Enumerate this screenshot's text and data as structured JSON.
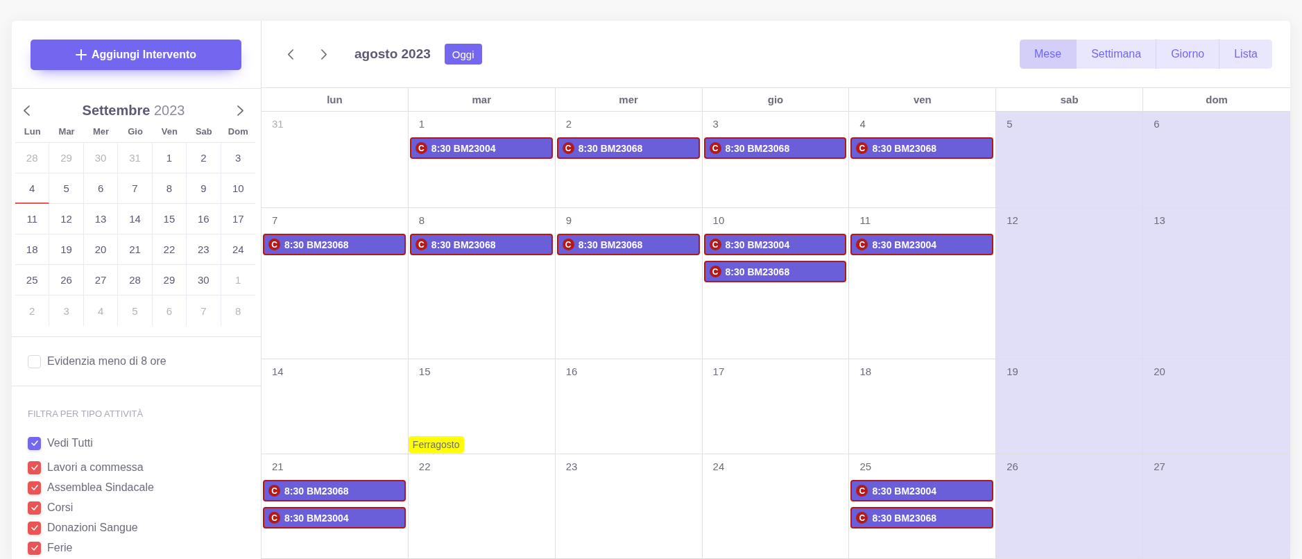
{
  "sidebar": {
    "add_button": {
      "label": "Aggiungi Intervento"
    },
    "mini_calendar": {
      "month": "Settembre",
      "year": "2023",
      "weekdays": [
        "Lun",
        "Mar",
        "Mer",
        "Gio",
        "Ven",
        "Sab",
        "Dom"
      ],
      "weeks": [
        [
          {
            "day": "28",
            "outside": true,
            "today": false
          },
          {
            "day": "29",
            "outside": true,
            "today": false
          },
          {
            "day": "30",
            "outside": true,
            "today": false
          },
          {
            "day": "31",
            "outside": true,
            "today": false
          },
          {
            "day": "1",
            "outside": false,
            "today": false
          },
          {
            "day": "2",
            "outside": false,
            "today": false
          },
          {
            "day": "3",
            "outside": false,
            "today": false
          }
        ],
        [
          {
            "day": "4",
            "outside": false,
            "today": true
          },
          {
            "day": "5",
            "outside": false,
            "today": false
          },
          {
            "day": "6",
            "outside": false,
            "today": false
          },
          {
            "day": "7",
            "outside": false,
            "today": false
          },
          {
            "day": "8",
            "outside": false,
            "today": false
          },
          {
            "day": "9",
            "outside": false,
            "today": false
          },
          {
            "day": "10",
            "outside": false,
            "today": false
          }
        ],
        [
          {
            "day": "11",
            "outside": false,
            "today": false
          },
          {
            "day": "12",
            "outside": false,
            "today": false
          },
          {
            "day": "13",
            "outside": false,
            "today": false
          },
          {
            "day": "14",
            "outside": false,
            "today": false
          },
          {
            "day": "15",
            "outside": false,
            "today": false
          },
          {
            "day": "16",
            "outside": false,
            "today": false
          },
          {
            "day": "17",
            "outside": false,
            "today": false
          }
        ],
        [
          {
            "day": "18",
            "outside": false,
            "today": false
          },
          {
            "day": "19",
            "outside": false,
            "today": false
          },
          {
            "day": "20",
            "outside": false,
            "today": false
          },
          {
            "day": "21",
            "outside": false,
            "today": false
          },
          {
            "day": "22",
            "outside": false,
            "today": false
          },
          {
            "day": "23",
            "outside": false,
            "today": false
          },
          {
            "day": "24",
            "outside": false,
            "today": false
          }
        ],
        [
          {
            "day": "25",
            "outside": false,
            "today": false
          },
          {
            "day": "26",
            "outside": false,
            "today": false
          },
          {
            "day": "27",
            "outside": false,
            "today": false
          },
          {
            "day": "28",
            "outside": false,
            "today": false
          },
          {
            "day": "29",
            "outside": false,
            "today": false
          },
          {
            "day": "30",
            "outside": false,
            "today": false
          },
          {
            "day": "1",
            "outside": true,
            "today": false
          }
        ],
        [
          {
            "day": "2",
            "outside": true,
            "today": false
          },
          {
            "day": "3",
            "outside": true,
            "today": false
          },
          {
            "day": "4",
            "outside": true,
            "today": false
          },
          {
            "day": "5",
            "outside": true,
            "today": false
          },
          {
            "day": "6",
            "outside": true,
            "today": false
          },
          {
            "day": "7",
            "outside": true,
            "today": false
          },
          {
            "day": "8",
            "outside": true,
            "today": false
          }
        ]
      ]
    },
    "highlight_option": {
      "label": "Evidenzia meno di 8 ore",
      "checked": false
    },
    "filters": {
      "title": "FILTRA PER TIPO ATTIVITÀ",
      "items": [
        {
          "label": "Vedi Tutti",
          "checked": true,
          "color": "#7367f0"
        },
        {
          "label": "Lavori a commessa",
          "checked": true,
          "color": "#ea5455"
        },
        {
          "label": "Assemblea Sindacale",
          "checked": true,
          "color": "#ea5455"
        },
        {
          "label": "Corsi",
          "checked": true,
          "color": "#ea5455"
        },
        {
          "label": "Donazioni Sangue",
          "checked": true,
          "color": "#ea5455"
        },
        {
          "label": "Ferie",
          "checked": true,
          "color": "#ea5455"
        }
      ]
    }
  },
  "calendar": {
    "title": "agosto 2023",
    "today_button": "Oggi",
    "views": [
      {
        "label": "Mese",
        "selected": true
      },
      {
        "label": "Settimana",
        "selected": false
      },
      {
        "label": "Giorno",
        "selected": false
      },
      {
        "label": "Lista",
        "selected": false
      }
    ],
    "day_headers": [
      {
        "label": "lun",
        "weekend": false
      },
      {
        "label": "mar",
        "weekend": false
      },
      {
        "label": "mer",
        "weekend": false
      },
      {
        "label": "gio",
        "weekend": false
      },
      {
        "label": "ven",
        "weekend": false
      },
      {
        "label": "sab",
        "weekend": true
      },
      {
        "label": "dom",
        "weekend": true
      }
    ],
    "weeks": [
      [
        {
          "day": "31",
          "outside": true
        },
        {
          "day": "1",
          "outside": false,
          "events": [
            {
              "kind": "job",
              "badge": "C",
              "time": "8:30",
              "title": "BM23004"
            }
          ]
        },
        {
          "day": "2",
          "outside": false,
          "events": [
            {
              "kind": "job",
              "badge": "C",
              "time": "8:30",
              "title": "BM23068"
            }
          ]
        },
        {
          "day": "3",
          "outside": false,
          "events": [
            {
              "kind": "job",
              "badge": "C",
              "time": "8:30",
              "title": "BM23068"
            }
          ]
        },
        {
          "day": "4",
          "outside": false,
          "events": [
            {
              "kind": "job",
              "badge": "C",
              "time": "8:30",
              "title": "BM23068"
            }
          ]
        },
        {
          "day": "5",
          "outside": false
        },
        {
          "day": "6",
          "outside": false
        }
      ],
      [
        {
          "day": "7",
          "outside": false,
          "events": [
            {
              "kind": "job",
              "badge": "C",
              "time": "8:30",
              "title": "BM23068"
            }
          ]
        },
        {
          "day": "8",
          "outside": false,
          "events": [
            {
              "kind": "job",
              "badge": "C",
              "time": "8:30",
              "title": "BM23068"
            }
          ]
        },
        {
          "day": "9",
          "outside": false,
          "events": [
            {
              "kind": "job",
              "badge": "C",
              "time": "8:30",
              "title": "BM23068"
            }
          ]
        },
        {
          "day": "10",
          "outside": false,
          "events": [
            {
              "kind": "job",
              "badge": "C",
              "time": "8:30",
              "title": "BM23004"
            },
            {
              "kind": "job",
              "badge": "C",
              "time": "8:30",
              "title": "BM23068"
            }
          ]
        },
        {
          "day": "11",
          "outside": false,
          "events": [
            {
              "kind": "job",
              "badge": "C",
              "time": "8:30",
              "title": "BM23004"
            }
          ]
        },
        {
          "day": "12",
          "outside": false
        },
        {
          "day": "13",
          "outside": false
        }
      ],
      [
        {
          "day": "14",
          "outside": false
        },
        {
          "day": "15",
          "outside": false,
          "events": [
            {
              "kind": "holiday",
              "title": "Ferragosto"
            }
          ]
        },
        {
          "day": "16",
          "outside": false
        },
        {
          "day": "17",
          "outside": false
        },
        {
          "day": "18",
          "outside": false
        },
        {
          "day": "19",
          "outside": false
        },
        {
          "day": "20",
          "outside": false
        }
      ],
      [
        {
          "day": "21",
          "outside": false,
          "events": [
            {
              "kind": "job",
              "badge": "C",
              "time": "8:30",
              "title": "BM23068"
            },
            {
              "kind": "job",
              "badge": "C",
              "time": "8:30",
              "title": "BM23004"
            }
          ]
        },
        {
          "day": "22",
          "outside": false
        },
        {
          "day": "23",
          "outside": false
        },
        {
          "day": "24",
          "outside": false
        },
        {
          "day": "25",
          "outside": false,
          "events": [
            {
              "kind": "job",
              "badge": "C",
              "time": "8:30",
              "title": "BM23004"
            },
            {
              "kind": "job",
              "badge": "C",
              "time": "8:30",
              "title": "BM23068"
            }
          ]
        },
        {
          "day": "26",
          "outside": false
        },
        {
          "day": "27",
          "outside": false
        }
      ]
    ]
  }
}
